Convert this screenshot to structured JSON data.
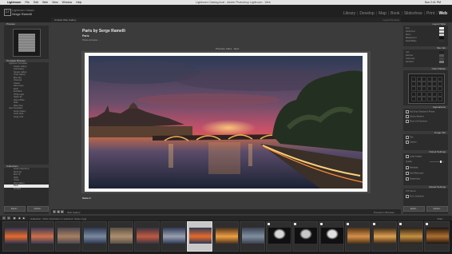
{
  "menubar": {
    "apple": "",
    "items": [
      "Lightroom",
      "File",
      "Edit",
      "Web",
      "View",
      "Window",
      "Help"
    ],
    "doc_title": "Lightroom Catalog.lrcat - Adobe Photoshop Lightroom - Web",
    "clock": "Sun 2:41 PM"
  },
  "identity": {
    "logo": "Lr",
    "plate_top": "Lightroom Classic",
    "plate_name": "Serge Ramelli"
  },
  "modules": [
    "Library",
    "Develop",
    "Map",
    "Book",
    "Slideshow",
    "Print",
    "Web"
  ],
  "active_module": "Web",
  "left_panel": {
    "preview_header": "Preview",
    "template_header": "Template Browser",
    "templates": [
      "Lightroom Templates",
      "Classic Gallery",
      "Grid Gallery",
      "Square Gallery",
      "Track Gallery",
      "Blue Sky",
      "Charcoal",
      "Classic",
      "Dark Clean",
      "Earth",
      "Exhibition",
      "HTML Light",
      "Night Life",
      "Paper White",
      "Slate",
      "Warm Day",
      "User Templates",
      "Serge Gallery",
      "Clean Web",
      "Serge Grid"
    ],
    "collections_header": "Collections",
    "collections": [
      "Smart Collections",
      "Paris Set",
      "Best Of",
      "Night",
      "Travel",
      "Web Gallery",
      "Paris",
      "Portfolio"
    ],
    "selected_collection": "Paris",
    "export_button": "Export...",
    "upload_button": "Upload..."
  },
  "center": {
    "layout_label": "Untitled Web Gallery",
    "url_label": "Layout Preview",
    "site_title": "Paris by Serge Ramelli",
    "site_sub1": "Paris",
    "site_sub2": "Photo Acrosss ...",
    "nav_prev": "Previous",
    "nav_index": "Index",
    "nav_next": "Next",
    "caption": "Seine 2"
  },
  "toolbar": {
    "label": "Web Gallery",
    "right_text": "Preview in Browser..."
  },
  "right_panel": {
    "layout_style_header": "Layout Style",
    "site_info_header": "Site Info",
    "color_palette_header": "Color Palette",
    "appearance_header": "Appearance",
    "image_info_header": "Image Info",
    "output_settings_header": "Output Settings",
    "upload_settings_header": "Upload Settings",
    "rows": [
      "Text",
      "Detail Text",
      "Menu",
      "Background",
      "Detail Matte",
      "Cell",
      "Rollover",
      "Grid Lines",
      "Numbers"
    ],
    "appearance_rows": [
      "Add Drop Shadow to Photos",
      "Section Borders",
      "Show Cell Numbers"
    ],
    "image_info_rows": [
      "Title",
      "Caption"
    ],
    "output_rows": [
      "Large Images",
      "Quality",
      "Metadata",
      "Add Watermark",
      "Sharpening"
    ],
    "quality_value": "70",
    "upload_rows": [
      "FTP Server",
      "Put in Subfolder"
    ],
    "preview_button": "Preview in Browser...",
    "export_button": "Export...",
    "upload_button": "Upload..."
  },
  "filmstrip_bar": {
    "text": "Collection : Paris    14 photos / 1 selected / Seine 2.jpg",
    "page1": "1",
    "page2": "2",
    "filter_label": "Filter :"
  },
  "colors": {
    "sky_top": "#3b4a66",
    "sunset_orange": "#e86a2b",
    "sunset_pink": "#c64a6a",
    "water": "#1f2b3d",
    "accent_text": "#f0f0f0"
  }
}
